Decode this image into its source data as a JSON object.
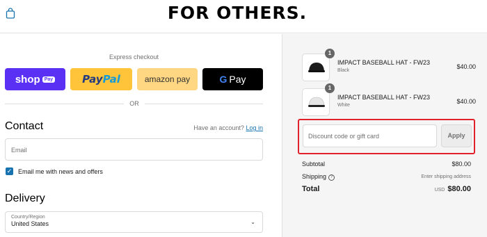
{
  "header": {
    "brand": "FOR OTHERS.",
    "bag_icon": "shopping-bag-icon"
  },
  "express": {
    "title": "Express checkout",
    "shop_pay": {
      "word": "shop",
      "badge": "Pay"
    },
    "paypal": {
      "part1": "Pay",
      "part2": "Pal"
    },
    "amazon": "amazon pay",
    "gpay": {
      "g": "G",
      "text": "Pay"
    },
    "or": "OR"
  },
  "contact": {
    "heading": "Contact",
    "have_account": "Have an account?",
    "login": "Log in",
    "email_placeholder": "Email",
    "newsletter_label": "Email me with news and offers",
    "newsletter_checked": true
  },
  "delivery": {
    "heading": "Delivery",
    "country_label": "Country/Region",
    "country_value": "United States"
  },
  "order": {
    "items": [
      {
        "qty": "1",
        "name": "IMPACT BASEBALL HAT - FW23",
        "variant": "Black",
        "price": "$40.00",
        "hat_color": "#1c1c1c"
      },
      {
        "qty": "1",
        "name": "IMPACT BASEBALL HAT - FW23",
        "variant": "White",
        "price": "$40.00",
        "hat_color": "#e6e6e6"
      }
    ],
    "discount_placeholder": "Discount code or gift card",
    "apply_label": "Apply",
    "subtotal_label": "Subtotal",
    "subtotal_value": "$80.00",
    "shipping_label": "Shipping",
    "shipping_value": "Enter shipping address",
    "total_label": "Total",
    "currency": "USD",
    "total_value": "$80.00"
  },
  "colors": {
    "shop_pay": "#5a31f4",
    "paypal": "#ffc439",
    "amazon": "#ffd681",
    "gpay": "#000000",
    "link": "#1773b0",
    "highlight": "#e0202a"
  }
}
